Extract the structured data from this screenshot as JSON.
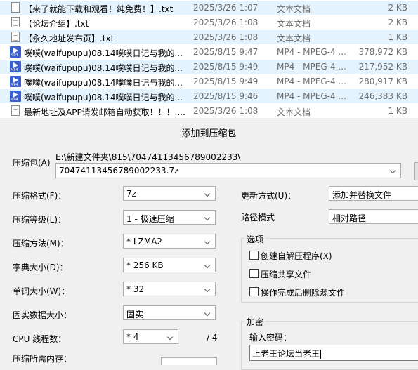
{
  "files": [
    {
      "name": "【来了就能下载和观看！纯免费！】.txt",
      "date": "2025/3/26 1:07",
      "type": "文本文档",
      "size": "2 KB",
      "icon": "txt-file-icon",
      "highlight": true
    },
    {
      "name": "【论坛介绍】.txt",
      "date": "2025/3/26 1:08",
      "type": "文本文档",
      "size": "2 KB",
      "icon": "txt-file-icon",
      "highlight": false
    },
    {
      "name": "【永久地址发布页】.txt",
      "date": "2025/3/26 1:08",
      "type": "文本文档",
      "size": "1 KB",
      "icon": "txt-file-icon",
      "highlight": true
    },
    {
      "name": "噗噗(waifupupu)08.14噗噗日记与我的...",
      "date": "2025/8/15 9:47",
      "type": "MP4 - MPEG-4 ...",
      "size": "378,972 KB",
      "icon": "mp4-file-icon",
      "highlight": false
    },
    {
      "name": "噗噗(waifupupu)08.14噗噗日记与我的...",
      "date": "2025/8/15 9:49",
      "type": "MP4 - MPEG-4 ...",
      "size": "217,952 KB",
      "icon": "mp4-file-icon",
      "highlight": true
    },
    {
      "name": "噗噗(waifupupu)08.14噗噗日记与我的...",
      "date": "2025/8/15 9:49",
      "type": "MP4 - MPEG-4 ...",
      "size": "280,917 KB",
      "icon": "mp4-file-icon",
      "highlight": false
    },
    {
      "name": "噗噗(waifupupu)08.14噗噗日记与我的...",
      "date": "2025/8/15 9:46",
      "type": "MP4 - MPEG-4 ...",
      "size": "246,383 KB",
      "icon": "mp4-file-icon",
      "highlight": true
    },
    {
      "name": "最新地址及APP请发邮箱自动获取！！！....",
      "date": "2025/3/26 1:08",
      "type": "文本文档",
      "size": "1 KB",
      "icon": "txt-file-icon",
      "highlight": false
    }
  ],
  "dialog": {
    "title": "添加到压缩包",
    "archive_label": "压缩包(A)",
    "archive_path": "E:\\新建文件夹\\815\\70474113456789002233\\",
    "archive_name": "70474113456789002233.7z",
    "format_label": "压缩格式(F)：",
    "format_value": "7z",
    "level_label": "压缩等级(L)：",
    "level_value": "1 - 极速压缩",
    "method_label": "压缩方法(M)：",
    "method_value": "* LZMA2",
    "dict_label": "字典大小(D)：",
    "dict_value": "* 256 KB",
    "word_label": "单词大小(W)：",
    "word_value": "* 32",
    "solid_label": "固实数据大小：",
    "solid_value": "固实",
    "cpu_label": "CPU 线程数：",
    "cpu_value": "* 4",
    "cpu_total": "/ 4",
    "memory_label": "压缩所需内存：",
    "update_label": "更新方式(U)：",
    "update_value": "添加并替换文件",
    "path_label": "路径模式",
    "path_value": "相对路径",
    "options_group": "选项",
    "opt_sfx": "创建自解压程序(X)",
    "opt_shared": "压缩共享文件",
    "opt_delete": "操作完成后删除源文件",
    "encrypt_group": "加密",
    "password_label": "输入密码：",
    "password_value": "上老王论坛当老王"
  }
}
